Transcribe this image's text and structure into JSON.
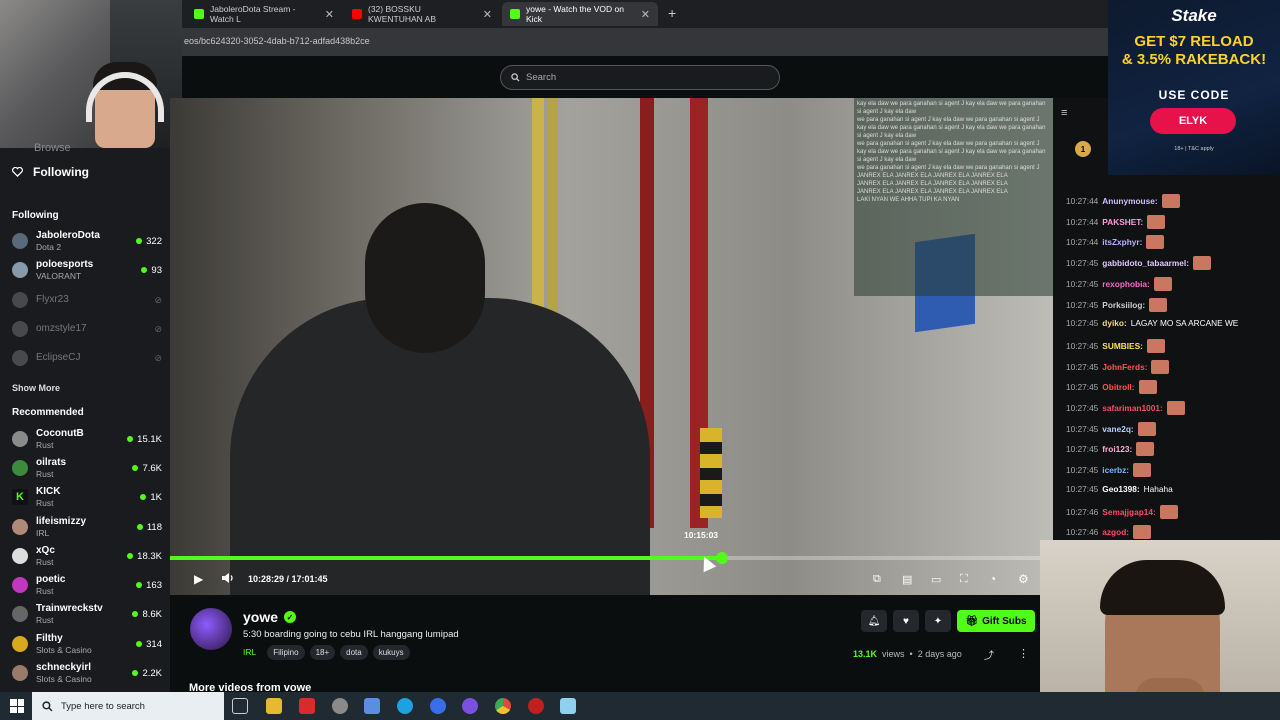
{
  "browser": {
    "tabs": [
      {
        "label": "JaboleroDota Stream - Watch L",
        "favicon_color": "#53fc18"
      },
      {
        "label": "(32) BOSSKU KWENTUHAN AB",
        "favicon_color": "#ff0000"
      },
      {
        "label": "yowe - Watch the VOD on Kick",
        "favicon_color": "#53fc18"
      }
    ],
    "url": "eos/bc624320-3052-4dab-b712-adfad438b2ce"
  },
  "header": {
    "search_placeholder": "Search"
  },
  "sidebar": {
    "browse_label": "Browse",
    "following_nav_label": "Following",
    "following_title": "Following",
    "following": [
      {
        "name": "JaboleroDota",
        "category": "Dota 2",
        "viewers": "322",
        "live": true,
        "avatar_color": "#5a6a7a"
      },
      {
        "name": "poloesports",
        "category": "VALORANT",
        "viewers": "93",
        "live": true,
        "avatar_color": "#8899aa"
      },
      {
        "name": "Flyxr23",
        "category": "",
        "viewers": "",
        "live": false,
        "avatar_color": "#777777"
      },
      {
        "name": "omzstyle17",
        "category": "",
        "viewers": "",
        "live": false,
        "avatar_color": "#777777"
      },
      {
        "name": "EclipseCJ",
        "category": "",
        "viewers": "",
        "live": false,
        "avatar_color": "#777777"
      }
    ],
    "show_more": "Show More",
    "recommended_title": "Recommended",
    "recommended": [
      {
        "name": "CoconutB",
        "category": "Rust",
        "viewers": "15.1K",
        "avatar_color": "#8a8a8a"
      },
      {
        "name": "oilrats",
        "category": "Rust",
        "viewers": "7.6K",
        "avatar_color": "#3c8a3c"
      },
      {
        "name": "KICK",
        "category": "Rust",
        "viewers": "1K",
        "avatar_color": "#111111"
      },
      {
        "name": "lifeismizzy",
        "category": "IRL",
        "viewers": "118",
        "avatar_color": "#b08a78"
      },
      {
        "name": "xQc",
        "category": "Rust",
        "viewers": "18.3K",
        "avatar_color": "#dddddd"
      },
      {
        "name": "poetic",
        "category": "Rust",
        "viewers": "163",
        "avatar_color": "#c038c0"
      },
      {
        "name": "Trainwreckstv",
        "category": "Rust",
        "viewers": "8.6K",
        "avatar_color": "#666666"
      },
      {
        "name": "Filthy",
        "category": "Slots & Casino",
        "viewers": "314",
        "avatar_color": "#d8a820"
      },
      {
        "name": "schneckyirl",
        "category": "Slots & Casino",
        "viewers": "2.2K",
        "avatar_color": "#9a7a6a"
      }
    ]
  },
  "video": {
    "hover_time": "10:15:03",
    "current_time": "10:28:29 / 17:01:45",
    "progress_fraction": 0.625,
    "overlay_lines": [
      "kay ela daw we para ganahan si agent J kay ela daw we para ganahan si agent J kay ela daw",
      "we para ganahan si agent J kay ela daw we para ganahan si agent J",
      "JANREX ELA JANREX ELA JANREX ELA JANREX ELA",
      "LAKI NYAN WE AHHA TUPI KA NYAN"
    ]
  },
  "channel": {
    "name": "yowe",
    "title": "5:30 boarding going to cebu IRL hanggang lumipad",
    "category": "IRL",
    "tags": [
      "Filipino",
      "18+",
      "dota",
      "kukuys"
    ],
    "views": "13.1K",
    "views_label": "views",
    "age": "2 days ago",
    "gift_label": "Gift Subs",
    "more_videos": "More videos from vowe"
  },
  "chat": {
    "messages": [
      {
        "time": "10:27:44",
        "user": "Anunymouse:",
        "text": "",
        "color": "#cfc0ff",
        "emote": true
      },
      {
        "time": "10:27:44",
        "user": "PAKSHET:",
        "text": "",
        "color": "#ff9be0",
        "emote": true
      },
      {
        "time": "10:27:44",
        "user": "itsZxphyr:",
        "text": "",
        "color": "#b9b3ff",
        "emote": true
      },
      {
        "time": "10:27:45",
        "user": "gabbidoto_tabaarmel:",
        "text": "",
        "color": "#e4c7ff",
        "emote": true
      },
      {
        "time": "10:27:45",
        "user": "rexophobia:",
        "text": "",
        "color": "#ff66cc",
        "emote": true
      },
      {
        "time": "10:27:45",
        "user": "Porksiilog:",
        "text": "",
        "color": "#cfcfcf",
        "emote": true
      },
      {
        "time": "10:27:45",
        "user": "dyiko:",
        "text": "LAGAY MO SA ARCANE WE",
        "color": "#ffd58a",
        "emote": false
      },
      {
        "time": "10:27:45",
        "user": "SUMBIES:",
        "text": "",
        "color": "#ffe14a",
        "emote": true
      },
      {
        "time": "10:27:45",
        "user": "JohnFerds:",
        "text": "",
        "color": "#ff5252",
        "emote": true
      },
      {
        "time": "10:27:45",
        "user": "Obitroll:",
        "text": "",
        "color": "#ff5252",
        "emote": true
      },
      {
        "time": "10:27:45",
        "user": "safariman1001:",
        "text": "",
        "color": "#ff4a6a",
        "emote": true
      },
      {
        "time": "10:27:45",
        "user": "vane2q:",
        "text": "",
        "color": "#b6d3ff",
        "emote": true
      },
      {
        "time": "10:27:45",
        "user": "froi123:",
        "text": "",
        "color": "#ffb0d8",
        "emote": true
      },
      {
        "time": "10:27:45",
        "user": "icerbz:",
        "text": "",
        "color": "#7fb8ff",
        "emote": true
      },
      {
        "time": "10:27:45",
        "user": "Geo1398:",
        "text": "Hahaha",
        "color": "#ffffff",
        "emote": false
      },
      {
        "time": "10:27:46",
        "user": "Semajjgap14:",
        "text": "",
        "color": "#ff4a6a",
        "emote": true
      },
      {
        "time": "10:27:46",
        "user": "azgod:",
        "text": "",
        "color": "#ff4a6a",
        "emote": true
      }
    ]
  },
  "ad": {
    "brand": "Stake",
    "line1": "GET $7 RELOAD",
    "line2": "& 3.5% RAKEBACK!",
    "use_code": "USE CODE",
    "code": "ELYK",
    "fine_print": "18+ | T&C apply"
  },
  "taskbar": {
    "search_placeholder": "Type here to search"
  },
  "colors": {
    "accent": "#53fc18",
    "background": "#0b0e0f",
    "sidebar": "#191b1f"
  }
}
